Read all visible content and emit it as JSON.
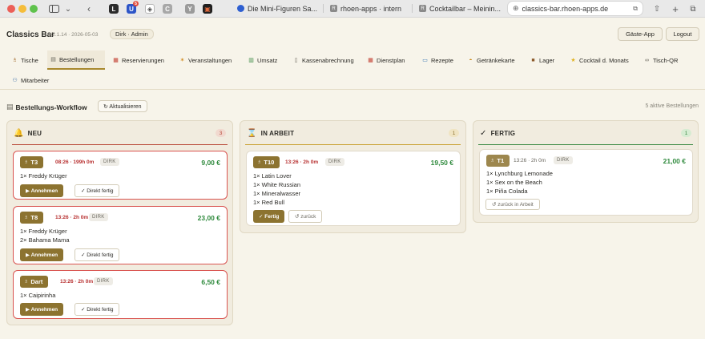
{
  "browser": {
    "tabs": [
      {
        "label": "Die Mini-Figuren Sa...",
        "fav": "S"
      },
      {
        "label": "rhoen-apps · intern",
        "fav": "R"
      },
      {
        "label": "Cocktailbar – Meinin...",
        "fav": "R"
      },
      {
        "label": "classics-bar.rhoen-apps.de",
        "fav": "globe"
      }
    ],
    "ext_badge": "5"
  },
  "header": {
    "brand": "Classics Bar",
    "version": "v2.1.14 · 2026-05-03",
    "user": "Dirk · Admin",
    "guest_app": "Gäste-App",
    "logout": "Logout"
  },
  "nav": [
    {
      "label": "Tische",
      "icon": "table-icon"
    },
    {
      "label": "Bestellungen",
      "icon": "clipboard-icon",
      "active": true
    },
    {
      "label": "Reservierungen",
      "icon": "calendar-icon"
    },
    {
      "label": "Veranstaltungen",
      "icon": "party-icon"
    },
    {
      "label": "Umsatz",
      "icon": "chart-icon"
    },
    {
      "label": "Kassenabrechnung",
      "icon": "receipt-icon"
    },
    {
      "label": "Dienstplan",
      "icon": "schedule-icon"
    },
    {
      "label": "Rezepte",
      "icon": "book-icon"
    },
    {
      "label": "Getränkekarte",
      "icon": "drink-icon"
    },
    {
      "label": "Lager",
      "icon": "box-icon"
    },
    {
      "label": "Cocktail d. Monats",
      "icon": "star-icon"
    },
    {
      "label": "Tisch-QR",
      "icon": "link-icon"
    },
    {
      "label": "Mitarbeiter",
      "icon": "people-icon"
    }
  ],
  "workflow": {
    "title": "Bestellungs-Workflow",
    "refresh": "↻ Aktualisieren",
    "active_count": "5 aktive Bestellungen"
  },
  "columns": [
    {
      "title": "NEU",
      "count": "3",
      "icon": "bell-icon",
      "accent": "#b94a3a",
      "cards": [
        {
          "table": "T3",
          "time": "08:26 · 199h 0m",
          "staff": "DIRK",
          "price": "9,00 €",
          "items": [
            "1× Freddy Krüger"
          ],
          "primary": "▶ Annehmen",
          "secondary": "✓ Direkt fertig"
        },
        {
          "table": "T8",
          "time": "13:26 · 2h 0m",
          "staff": "DIRK",
          "price": "23,00 €",
          "items": [
            "1× Freddy Krüger",
            "2× Bahama Mama"
          ],
          "primary": "▶ Annehmen",
          "secondary": "✓ Direkt fertig"
        },
        {
          "table": "Dart",
          "time": "13:26 · 2h 0m",
          "staff": "DIRK",
          "price": "6,50 €",
          "items": [
            "1× Caipirinha"
          ],
          "primary": "▶ Annehmen",
          "secondary": "✓ Direkt fertig"
        }
      ]
    },
    {
      "title": "IN ARBEIT",
      "count": "1",
      "icon": "hourglass-icon",
      "accent": "#c9a234",
      "cards": [
        {
          "table": "T10",
          "time": "13:26 · 2h 0m",
          "staff": "DIRK",
          "price": "19,50 €",
          "items": [
            "1× Latin Lover",
            "1× White Russian",
            "1× Mineralwasser",
            "1× Red Bull"
          ],
          "primary": "✓ Fertig",
          "secondary": "↺ zurück"
        }
      ]
    },
    {
      "title": "FERTIG",
      "count": "1",
      "icon": "check-icon",
      "accent": "#3d8b45",
      "cards": [
        {
          "table": "T1",
          "time": "13:26 · 2h 0m",
          "staff": "DIRK",
          "price": "21,00 €",
          "items": [
            "1× Lynchburg Lemonade",
            "1× Sex on the Beach",
            "1× Piña Colada"
          ],
          "secondary": "↺ zurück in Arbeit"
        }
      ]
    }
  ]
}
